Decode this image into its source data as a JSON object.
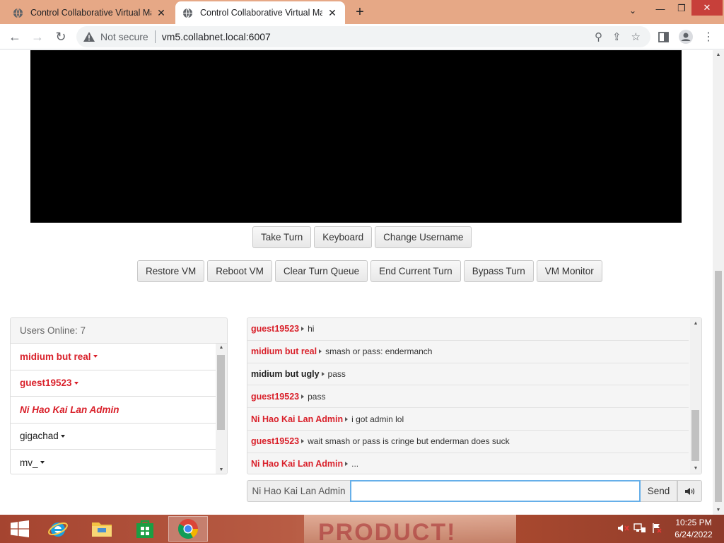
{
  "browser": {
    "tabs": [
      {
        "title": "Control Collaborative Virtual Ma",
        "active": false
      },
      {
        "title": "Control Collaborative Virtual Ma",
        "active": true
      }
    ],
    "security_label": "Not secure",
    "url": "vm5.collabnet.local:6007"
  },
  "vm_controls": {
    "row1": [
      "Take Turn",
      "Keyboard",
      "Change Username"
    ],
    "row2": [
      "Restore VM",
      "Reboot VM",
      "Clear Turn Queue",
      "End Current Turn",
      "Bypass Turn",
      "VM Monitor"
    ]
  },
  "users": {
    "header": "Users Online: 7",
    "list": [
      {
        "name": "midium but real",
        "style": "red",
        "menu": true
      },
      {
        "name": "guest19523",
        "style": "red",
        "menu": true
      },
      {
        "name": "Ni Hao Kai Lan Admin",
        "style": "red-italic",
        "menu": false
      },
      {
        "name": "gigachad",
        "style": "plain",
        "menu": true
      },
      {
        "name": "mv_",
        "style": "plain",
        "menu": true
      }
    ]
  },
  "chat": {
    "messages": [
      {
        "user": "guest19523",
        "color": "red",
        "text": "hi"
      },
      {
        "user": "midium but real",
        "color": "red",
        "text": "smash or pass: endermanch"
      },
      {
        "user": "midium but ugly",
        "color": "black",
        "text": "pass"
      },
      {
        "user": "guest19523",
        "color": "red",
        "text": "pass"
      },
      {
        "user": "Ni Hao Kai Lan Admin",
        "color": "red",
        "text": "i got admin lol"
      },
      {
        "user": "guest19523",
        "color": "red",
        "text": "wait smash or pass is cringe but enderman does suck"
      },
      {
        "user": "Ni Hao Kai Lan Admin",
        "color": "red",
        "text": "..."
      }
    ],
    "username": "Ni Hao Kai Lan Admin",
    "input_value": "",
    "send_label": "Send",
    "sound_icon": "speaker-icon"
  },
  "taskbar": {
    "apps": [
      "start-icon",
      "internet-explorer-icon",
      "file-explorer-icon",
      "store-icon",
      "chrome-icon"
    ],
    "wallpaper_text": "PRODUCT!",
    "time": "10:25 PM",
    "date": "6/24/2022"
  },
  "colors": {
    "tabstrip": "#e6a886",
    "admin_red": "#d9202a",
    "input_focus": "#66afe9"
  }
}
